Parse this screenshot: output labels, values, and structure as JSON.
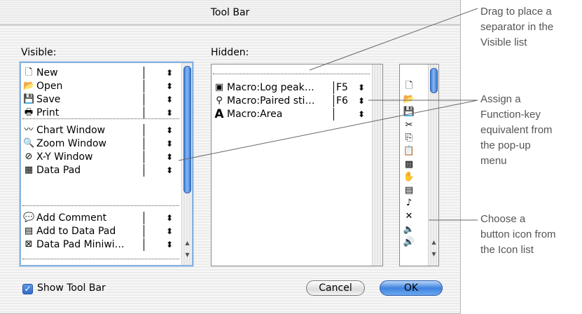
{
  "dialog": {
    "title": "Tool Bar",
    "visible_heading": "Visible:",
    "hidden_heading": "Hidden:",
    "show_toolbar_label": "Show Tool Bar",
    "show_toolbar_checked": true,
    "cancel_label": "Cancel",
    "ok_label": "OK"
  },
  "visible_list": {
    "group1": [
      {
        "icon": "new-icon",
        "glyph": "🗋",
        "label": "New"
      },
      {
        "icon": "open-icon",
        "glyph": "📂",
        "label": "Open"
      },
      {
        "icon": "save-icon",
        "glyph": "💾",
        "label": "Save"
      },
      {
        "icon": "print-icon",
        "glyph": "🖶",
        "label": "Print"
      }
    ],
    "group2": [
      {
        "icon": "chart-window-icon",
        "glyph": "〰",
        "label": "Chart Window"
      },
      {
        "icon": "zoom-window-icon",
        "glyph": "🔍",
        "label": "Zoom Window"
      },
      {
        "icon": "xy-window-icon",
        "glyph": "⊘",
        "label": "X-Y Window"
      },
      {
        "icon": "data-pad-icon",
        "glyph": "▦",
        "label": "Data Pad"
      }
    ],
    "group3": [
      {
        "icon": "add-comment-icon",
        "glyph": "💬",
        "label": "Add Comment"
      },
      {
        "icon": "add-to-data-pad-icon",
        "glyph": "▤",
        "label": "Add to Data Pad"
      },
      {
        "icon": "data-pad-miniwindow-icon",
        "glyph": "⊠",
        "label": "Data Pad Miniwi…"
      }
    ]
  },
  "hidden_list": [
    {
      "icon": "calculator-icon",
      "glyph": "▣",
      "label": "Macro:Log peak…",
      "key": "F5"
    },
    {
      "icon": "wand-icon",
      "glyph": "⚲",
      "label": "Macro:Paired sti…",
      "key": "F6"
    },
    {
      "icon": "area-a-icon",
      "glyph": "A",
      "label": "Macro:Area",
      "key": ""
    }
  ],
  "icon_list": [
    {
      "name": "document-icon",
      "glyph": "🗋"
    },
    {
      "name": "folder-open-icon",
      "glyph": "📂"
    },
    {
      "name": "floppy-icon",
      "glyph": "💾"
    },
    {
      "name": "scissors-icon",
      "glyph": "✂"
    },
    {
      "name": "copy-icon",
      "glyph": "⎘"
    },
    {
      "name": "clipboard-icon",
      "glyph": "📋"
    },
    {
      "name": "crosshatch-icon",
      "glyph": "▩"
    },
    {
      "name": "hand-icon",
      "glyph": "✋"
    },
    {
      "name": "calculator-icon",
      "glyph": "▤"
    },
    {
      "name": "note-icon",
      "glyph": "♪"
    },
    {
      "name": "x-icon",
      "glyph": "✕"
    },
    {
      "name": "speaker-pointer-icon",
      "glyph": "🔈"
    },
    {
      "name": "speaker-icon",
      "glyph": "🔊"
    }
  ],
  "callouts": {
    "separator": [
      "Drag to place a",
      "separator in the",
      "Visible list"
    ],
    "function_key": [
      "Assign a",
      "Function-key",
      "equivalent from",
      "the pop-up",
      "menu"
    ],
    "icon_list": [
      "Choose a",
      "button icon from",
      "the Icon list"
    ]
  },
  "colors": {
    "accent_blue": "#3f83df",
    "focus_ring": "#86b2e0",
    "callout_text": "#555555"
  }
}
